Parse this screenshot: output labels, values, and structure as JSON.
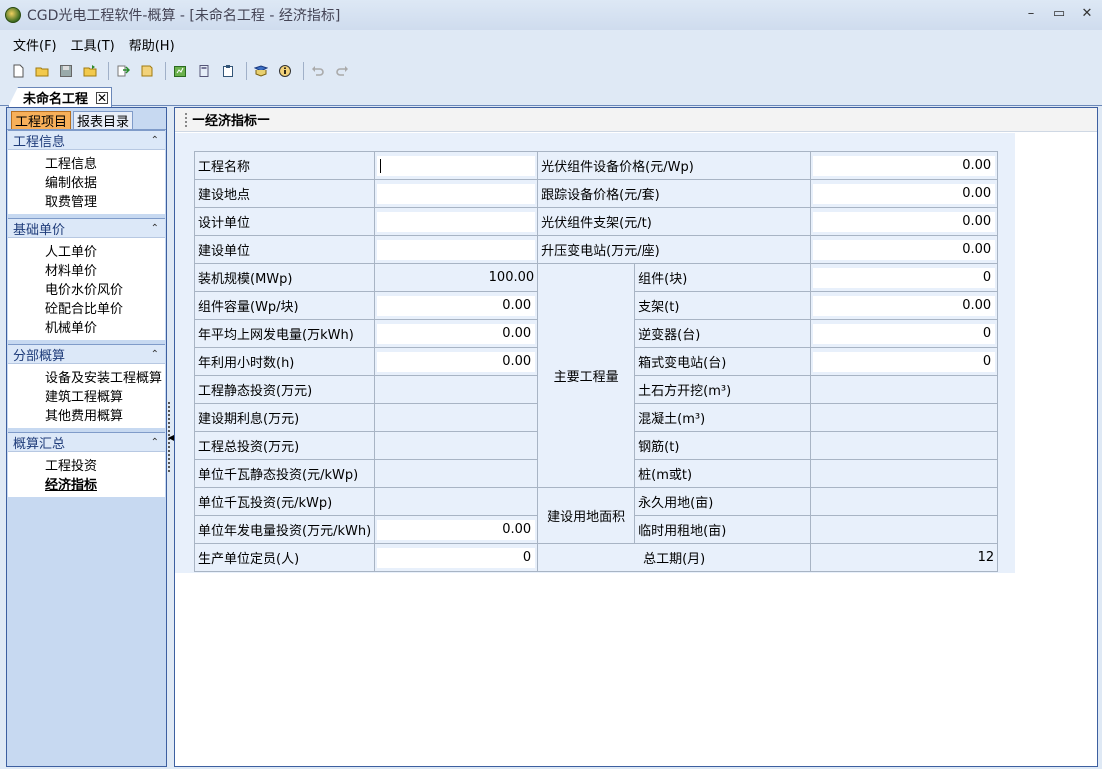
{
  "window": {
    "title": "CGD光电工程软件-概算 - [未命名工程 - 经济指标]",
    "min": "–",
    "max": "▭",
    "close": "✕"
  },
  "menu": [
    "文件(F)",
    "工具(T)",
    "帮助(H)"
  ],
  "doc_tab": {
    "label": "未命名工程",
    "close": "✕"
  },
  "left_tabs": [
    "工程项目",
    "报表目录"
  ],
  "sections": [
    {
      "title": "工程信息",
      "items": [
        "工程信息",
        "编制依据",
        "取费管理"
      ]
    },
    {
      "title": "基础单价",
      "items": [
        "人工单价",
        "材料单价",
        "电价水价风价",
        "砼配合比单价",
        "机械单价"
      ]
    },
    {
      "title": "分部概算",
      "items": [
        "设备及安装工程概算",
        "建筑工程概算",
        "其他费用概算"
      ]
    },
    {
      "title": "概算汇总",
      "items": [
        "工程投资",
        "经济指标"
      ]
    }
  ],
  "group_title": "经济指标",
  "form": {
    "rows_left": [
      {
        "label": "工程名称",
        "value": ""
      },
      {
        "label": "建设地点",
        "value": ""
      },
      {
        "label": "设计单位",
        "value": ""
      },
      {
        "label": "建设单位",
        "value": ""
      },
      {
        "label": "装机规模(MWp)",
        "value": "100.00"
      },
      {
        "label": "组件容量(Wp/块)",
        "value": "0.00"
      },
      {
        "label": "年平均上网发电量(万kWh)",
        "value": "0.00"
      },
      {
        "label": "年利用小时数(h)",
        "value": "0.00"
      },
      {
        "label": "工程静态投资(万元)",
        "value": ""
      },
      {
        "label": "建设期利息(万元)",
        "value": ""
      },
      {
        "label": "工程总投资(万元)",
        "value": ""
      },
      {
        "label": "单位千瓦静态投资(元/kWp)",
        "value": ""
      },
      {
        "label": "单位千瓦投资(元/kWp)",
        "value": ""
      },
      {
        "label": "单位年发电量投资(万元/kWh)",
        "value": "0.00"
      },
      {
        "label": "生产单位定员(人)",
        "value": "0"
      }
    ],
    "rows_right_top": [
      {
        "label": "光伏组件设备价格(元/Wp)",
        "value": "0.00"
      },
      {
        "label": "跟踪设备价格(元/套)",
        "value": "0.00"
      },
      {
        "label": "光伏组件支架(元/t)",
        "value": "0.00"
      },
      {
        "label": "升压变电站(万元/座)",
        "value": "0.00"
      }
    ],
    "main_quantity_label": "主要工程量",
    "main_quantity_rows": [
      {
        "label": "组件(块)",
        "value": "0"
      },
      {
        "label": "支架(t)",
        "value": "0.00"
      },
      {
        "label": "逆变器(台)",
        "value": "0"
      },
      {
        "label": "箱式变电站(台)",
        "value": "0"
      },
      {
        "label": "土石方开挖(m³)",
        "value": ""
      },
      {
        "label": "混凝土(m³)",
        "value": ""
      },
      {
        "label": "钢筋(t)",
        "value": ""
      },
      {
        "label": "桩(m或t)",
        "value": ""
      }
    ],
    "land_label": "建设用地面积",
    "land_rows": [
      {
        "label": "永久用地(亩)",
        "value": ""
      },
      {
        "label": "临时用租地(亩)",
        "value": ""
      }
    ],
    "duration_label": "总工期(月)",
    "duration_value": "12"
  }
}
